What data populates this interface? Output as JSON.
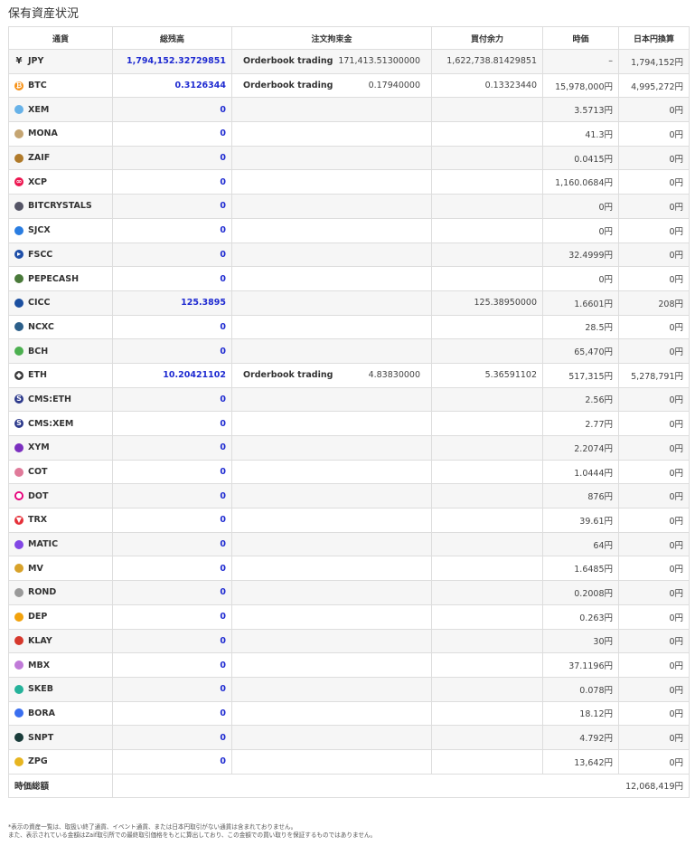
{
  "title": "保有資産状況",
  "headers": [
    "通貨",
    "総残高",
    "注文拘束金",
    "買付余力",
    "時価",
    "日本円換算"
  ],
  "rows": [
    {
      "currency": "JPY",
      "icon": "yen-icon",
      "icon_color": "#333333",
      "balance": "1,794,152.32729851",
      "order_kind": "Orderbook trading",
      "order_amount": "171,413.51300000",
      "buying_power": "1,622,738.81429851",
      "price": "–",
      "jpy": "1,794,152円"
    },
    {
      "currency": "BTC",
      "icon": "bitcoin-icon",
      "icon_color": "#f7931a",
      "balance": "0.3126344",
      "order_kind": "Orderbook trading",
      "order_amount": "0.17940000",
      "buying_power": "0.13323440",
      "price": "15,978,000円",
      "jpy": "4,995,272円"
    },
    {
      "currency": "XEM",
      "icon": "xem-icon",
      "icon_color": "#67b2e8",
      "balance": "0",
      "order_kind": "",
      "order_amount": "",
      "buying_power": "",
      "price": "3.5713円",
      "jpy": "0円"
    },
    {
      "currency": "MONA",
      "icon": "mona-icon",
      "icon_color": "#c5a572",
      "balance": "0",
      "order_kind": "",
      "order_amount": "",
      "buying_power": "",
      "price": "41.3円",
      "jpy": "0円"
    },
    {
      "currency": "ZAIF",
      "icon": "zaif-icon",
      "icon_color": "#b07a2a",
      "balance": "0",
      "order_kind": "",
      "order_amount": "",
      "buying_power": "",
      "price": "0.0415円",
      "jpy": "0円"
    },
    {
      "currency": "XCP",
      "icon": "xcp-icon",
      "icon_color": "#ed1650",
      "balance": "0",
      "order_kind": "",
      "order_amount": "",
      "buying_power": "",
      "price": "1,160.0684円",
      "jpy": "0円"
    },
    {
      "currency": "BITCRYSTALS",
      "icon": "bitcrystals-icon",
      "icon_color": "#555566",
      "balance": "0",
      "order_kind": "",
      "order_amount": "",
      "buying_power": "",
      "price": "0円",
      "jpy": "0円"
    },
    {
      "currency": "SJCX",
      "icon": "sjcx-icon",
      "icon_color": "#2a7de1",
      "balance": "0",
      "order_kind": "",
      "order_amount": "",
      "buying_power": "",
      "price": "0円",
      "jpy": "0円"
    },
    {
      "currency": "FSCC",
      "icon": "fscc-icon",
      "icon_color": "#1f4fa8",
      "balance": "0",
      "order_kind": "",
      "order_amount": "",
      "buying_power": "",
      "price": "32.4999円",
      "jpy": "0円"
    },
    {
      "currency": "PEPECASH",
      "icon": "pepecash-icon",
      "icon_color": "#4a7a3a",
      "balance": "0",
      "order_kind": "",
      "order_amount": "",
      "buying_power": "",
      "price": "0円",
      "jpy": "0円"
    },
    {
      "currency": "CICC",
      "icon": "cicc-icon",
      "icon_color": "#1b4fa0",
      "balance": "125.3895",
      "order_kind": "",
      "order_amount": "",
      "buying_power": "125.38950000",
      "price": "1.6601円",
      "jpy": "208円"
    },
    {
      "currency": "NCXC",
      "icon": "ncxc-icon",
      "icon_color": "#2c5f8a",
      "balance": "0",
      "order_kind": "",
      "order_amount": "",
      "buying_power": "",
      "price": "28.5円",
      "jpy": "0円"
    },
    {
      "currency": "BCH",
      "icon": "bch-icon",
      "icon_color": "#4cb050",
      "balance": "0",
      "order_kind": "",
      "order_amount": "",
      "buying_power": "",
      "price": "65,470円",
      "jpy": "0円"
    },
    {
      "currency": "ETH",
      "icon": "ethereum-icon",
      "icon_color": "#3c3c3d",
      "balance": "10.20421102",
      "order_kind": "Orderbook trading",
      "order_amount": "4.83830000",
      "buying_power": "5.36591102",
      "price": "517,315円",
      "jpy": "5,278,791円"
    },
    {
      "currency": "CMS:ETH",
      "icon": "cms-icon",
      "icon_color": "#2d3a8c",
      "balance": "0",
      "order_kind": "",
      "order_amount": "",
      "buying_power": "",
      "price": "2.56円",
      "jpy": "0円"
    },
    {
      "currency": "CMS:XEM",
      "icon": "cms-icon",
      "icon_color": "#2d3a8c",
      "balance": "0",
      "order_kind": "",
      "order_amount": "",
      "buying_power": "",
      "price": "2.77円",
      "jpy": "0円"
    },
    {
      "currency": "XYM",
      "icon": "xym-icon",
      "icon_color": "#7b2fbf",
      "balance": "0",
      "order_kind": "",
      "order_amount": "",
      "buying_power": "",
      "price": "2.2074円",
      "jpy": "0円"
    },
    {
      "currency": "COT",
      "icon": "cot-icon",
      "icon_color": "#e07a9a",
      "balance": "0",
      "order_kind": "",
      "order_amount": "",
      "buying_power": "",
      "price": "1.0444円",
      "jpy": "0円"
    },
    {
      "currency": "DOT",
      "icon": "polkadot-icon",
      "icon_color": "#e6007a",
      "balance": "0",
      "order_kind": "",
      "order_amount": "",
      "buying_power": "",
      "price": "876円",
      "jpy": "0円"
    },
    {
      "currency": "TRX",
      "icon": "tron-icon",
      "icon_color": "#e5313a",
      "balance": "0",
      "order_kind": "",
      "order_amount": "",
      "buying_power": "",
      "price": "39.61円",
      "jpy": "0円"
    },
    {
      "currency": "MATIC",
      "icon": "matic-icon",
      "icon_color": "#8247e5",
      "balance": "0",
      "order_kind": "",
      "order_amount": "",
      "buying_power": "",
      "price": "64円",
      "jpy": "0円"
    },
    {
      "currency": "MV",
      "icon": "mv-icon",
      "icon_color": "#d8a22a",
      "balance": "0",
      "order_kind": "",
      "order_amount": "",
      "buying_power": "",
      "price": "1.6485円",
      "jpy": "0円"
    },
    {
      "currency": "ROND",
      "icon": "rond-icon",
      "icon_color": "#999999",
      "balance": "0",
      "order_kind": "",
      "order_amount": "",
      "buying_power": "",
      "price": "0.2008円",
      "jpy": "0円"
    },
    {
      "currency": "DEP",
      "icon": "dep-icon",
      "icon_color": "#f2a20c",
      "balance": "0",
      "order_kind": "",
      "order_amount": "",
      "buying_power": "",
      "price": "0.263円",
      "jpy": "0円"
    },
    {
      "currency": "KLAY",
      "icon": "klay-icon",
      "icon_color": "#d6382c",
      "balance": "0",
      "order_kind": "",
      "order_amount": "",
      "buying_power": "",
      "price": "30円",
      "jpy": "0円"
    },
    {
      "currency": "MBX",
      "icon": "mbx-icon",
      "icon_color": "#c07ad8",
      "balance": "0",
      "order_kind": "",
      "order_amount": "",
      "buying_power": "",
      "price": "37.1196円",
      "jpy": "0円"
    },
    {
      "currency": "SKEB",
      "icon": "skeb-icon",
      "icon_color": "#25b29a",
      "balance": "0",
      "order_kind": "",
      "order_amount": "",
      "buying_power": "",
      "price": "0.078円",
      "jpy": "0円"
    },
    {
      "currency": "BORA",
      "icon": "bora-icon",
      "icon_color": "#3a6ff0",
      "balance": "0",
      "order_kind": "",
      "order_amount": "",
      "buying_power": "",
      "price": "18.12円",
      "jpy": "0円"
    },
    {
      "currency": "SNPT",
      "icon": "snpt-icon",
      "icon_color": "#1a3c3a",
      "balance": "0",
      "order_kind": "",
      "order_amount": "",
      "buying_power": "",
      "price": "4.792円",
      "jpy": "0円"
    },
    {
      "currency": "ZPG",
      "icon": "zpg-icon",
      "icon_color": "#e7b520",
      "balance": "0",
      "order_kind": "",
      "order_amount": "",
      "buying_power": "",
      "price": "13,642円",
      "jpy": "0円"
    }
  ],
  "total": {
    "label": "時価総額",
    "value": "12,068,419円"
  },
  "notes": [
    "*表示の資産一覧は、取扱い終了通貨、イベント通貨、または日本円取引がない通貨は含まれておりません。",
    "また、表示されている金額はZaif取引所での最終取引価格をもとに算出しており、この金額での買い取りを保証するものではありません。"
  ]
}
